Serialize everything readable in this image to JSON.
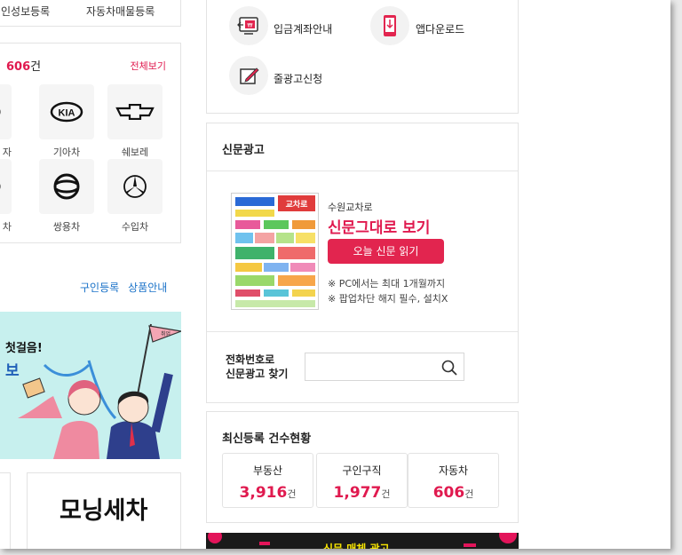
{
  "left": {
    "top_links": [
      "인성보등록",
      "자동차매물등록"
    ],
    "car_count": "606",
    "car_count_unit": "건",
    "view_all": "전체보기",
    "brands": [
      {
        "name": "자",
        "icon": "hyundai-logo-icon"
      },
      {
        "name": "기아차",
        "icon": "kia-logo-icon"
      },
      {
        "name": "쉐보레",
        "icon": "chevrolet-logo-icon"
      },
      {
        "name": "차",
        "icon": "renault-logo-icon"
      },
      {
        "name": "쌍용차",
        "icon": "ssangyong-logo-icon"
      },
      {
        "name": "수입차",
        "icon": "mercedes-logo-icon"
      }
    ],
    "links": [
      "구인등록",
      "상품안내"
    ],
    "banner": {
      "headline": "첫걸음!",
      "headline2": "보",
      "flag": "취업"
    },
    "morning_title": "모닝세차"
  },
  "menu": {
    "items": [
      {
        "label": "입금계좌안내",
        "icon": "bank-account-icon"
      },
      {
        "label": "앱다운로드",
        "icon": "mobile-app-icon"
      },
      {
        "label": "줄광고신청",
        "icon": "pencil-edit-icon"
      }
    ]
  },
  "newspaper": {
    "title": "신문광고",
    "route": "수원교차로",
    "see_paper": "신문그대로 보기",
    "read_button": "오늘 신문 읽기",
    "notes": [
      "※ PC에서는 최대 1개월까지",
      "※ 팝업차단 해지 필수, 설치X"
    ],
    "phone_label_line1": "전화번호로",
    "phone_label_line2": "신문광고 찾기",
    "phone_placeholder": "",
    "thumb_logo": "교차로"
  },
  "stats": {
    "title": "최신등록 건수현황",
    "items": [
      {
        "label": "부동산",
        "value": "3,916",
        "unit": "건"
      },
      {
        "label": "구인구직",
        "value": "1,977",
        "unit": "건"
      },
      {
        "label": "자동차",
        "value": "606",
        "unit": "건"
      }
    ]
  },
  "bottom_banner": {
    "text": "신문 매체 광고"
  },
  "colors": {
    "accent": "#e01a4f",
    "link": "#1a72c8",
    "banner_bg": "#c7f0ee"
  }
}
